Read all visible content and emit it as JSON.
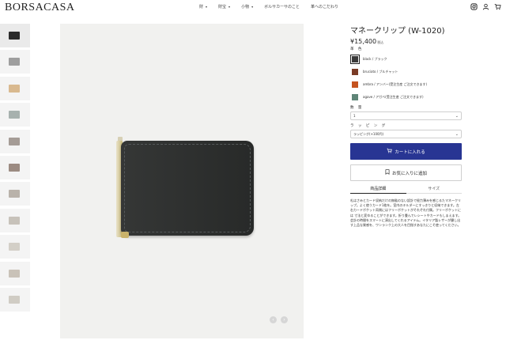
{
  "header": {
    "logo": "BORSACASA",
    "nav": [
      {
        "label": "財",
        "dropdown": true
      },
      {
        "label": "財宝",
        "dropdown": true
      },
      {
        "label": "小物",
        "dropdown": true
      },
      {
        "label": "ボルサカーサのこと",
        "dropdown": false
      },
      {
        "label": "革へのこだわり",
        "dropdown": false
      }
    ],
    "icons": [
      "instagram-icon",
      "user-icon",
      "cart-icon"
    ]
  },
  "gallery": {
    "thumbnail_colors": [
      "#2b2b2b",
      "#9e9e9e",
      "#d9b98f",
      "#a7b1ae",
      "#a59c96",
      "#9c8b82",
      "#b9b2aa",
      "#c7c2ba",
      "#d3cfc7",
      "#c9c2b8",
      "#d0ccc4"
    ],
    "active_index": 0,
    "prev_arrow": "‹",
    "next_arrow": "›"
  },
  "product": {
    "title": "マネークリップ (W-1020)",
    "price": "¥15,400",
    "tax_label": "税込",
    "color_label": "革 色",
    "colors": [
      {
        "name": "black / ブラック",
        "hex": "#3a3a3a",
        "selected": true
      },
      {
        "name": "bruciato / ブルチャット",
        "hex": "#7a3b26",
        "selected": false
      },
      {
        "name": "ambra / アンバー(受注生産 ご注文できます)",
        "hex": "#c5531f",
        "selected": false
      },
      {
        "name": "agave / アガベ(受注生産 ご注文できます)",
        "hex": "#5f8577",
        "selected": false
      }
    ],
    "quantity_label": "数 量",
    "quantity_value": "1",
    "wrapping_label": "ラ ッ ピ ン グ",
    "wrapping_value": "ラッピング(+100円)",
    "cart_button": "カートに入れる",
    "favorite_button": "お気に入りに追加",
    "tabs": [
      {
        "label": "商品詳細",
        "active": true
      },
      {
        "label": "サイズ",
        "active": false
      }
    ],
    "description": "札はさみとカード収納だけの無駄のない設計で極力薄みを感じるたマネークリップ。よく使うカード1枚を。室内のキルダーにすっきりと収納できます。左右カードポケット両側にはフリーポケットがそれぞれ付属。フリーポケットには 寸法と変ゆることができます。折り畳んでレシートやカードもしまえます。会計の時間をスマートに演出してくれるアイテム。イタリア製レザーが醸し出す上品な質感を、ワンランク上の大人を目指すあなたにこそ使ってください。"
  }
}
